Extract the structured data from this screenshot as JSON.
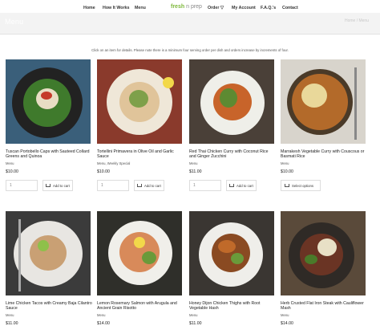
{
  "nav": {
    "items": [
      "Home",
      "How It Works",
      "Menu"
    ],
    "logo_fresh": "fresh",
    "logo_mid": "n",
    "logo_prep": "prep",
    "right_items": [
      "Order ▽",
      "My Account",
      "F.A.Q.'s",
      "Contact"
    ]
  },
  "hero": {
    "title": "Menu",
    "crumb": "Home / Menu"
  },
  "note": "Click on an item for details. Please note there is a minimum four serving order per dish and orders increase by increments of four.",
  "products": [
    {
      "title": "Tuscan Portobello Caps with Sauteed Collard Greens and Quinoa",
      "category": "Menu",
      "price": "$10.00",
      "qty_placeholder": "1",
      "action": "Add to cart"
    },
    {
      "title": "Tortellini Primavera in Olive Oil and Garlic Sauce",
      "category": "Menu, Weekly Special",
      "price": "$10.00",
      "qty_placeholder": "1",
      "action": "Add to cart"
    },
    {
      "title": "Red Thai Chicken Curry with Coconut Rice and Ginger Zucchini",
      "category": "Menu",
      "price": "$11.00",
      "qty_placeholder": "1",
      "action": "Add to cart"
    },
    {
      "title": "Marrakesh Vegetable Curry with Couscous or Basmati Rice",
      "category": "Menu",
      "price": "$10.00",
      "qty_placeholder": "",
      "action": "Select options"
    },
    {
      "title": "Lime Chicken Tacos with Creamy Baja Cilantro Sauce",
      "category": "Menu",
      "price": "$11.00",
      "qty_placeholder": "",
      "action": ""
    },
    {
      "title": "Lemon Rosemary Salmon with Arugula and Ancient Grain Risotto",
      "category": "Menu",
      "price": "$14.00",
      "qty_placeholder": "",
      "action": ""
    },
    {
      "title": "Honey Dijon Chicken Thighs with Root Vegetable Hash",
      "category": "Menu",
      "price": "$11.00",
      "qty_placeholder": "",
      "action": ""
    },
    {
      "title": "Herb Crusted Flat Iron Steak with Cauliflower Mash",
      "category": "Menu",
      "price": "$14.00",
      "qty_placeholder": "",
      "action": ""
    }
  ],
  "colors": {
    "accent": "#7db83a"
  }
}
